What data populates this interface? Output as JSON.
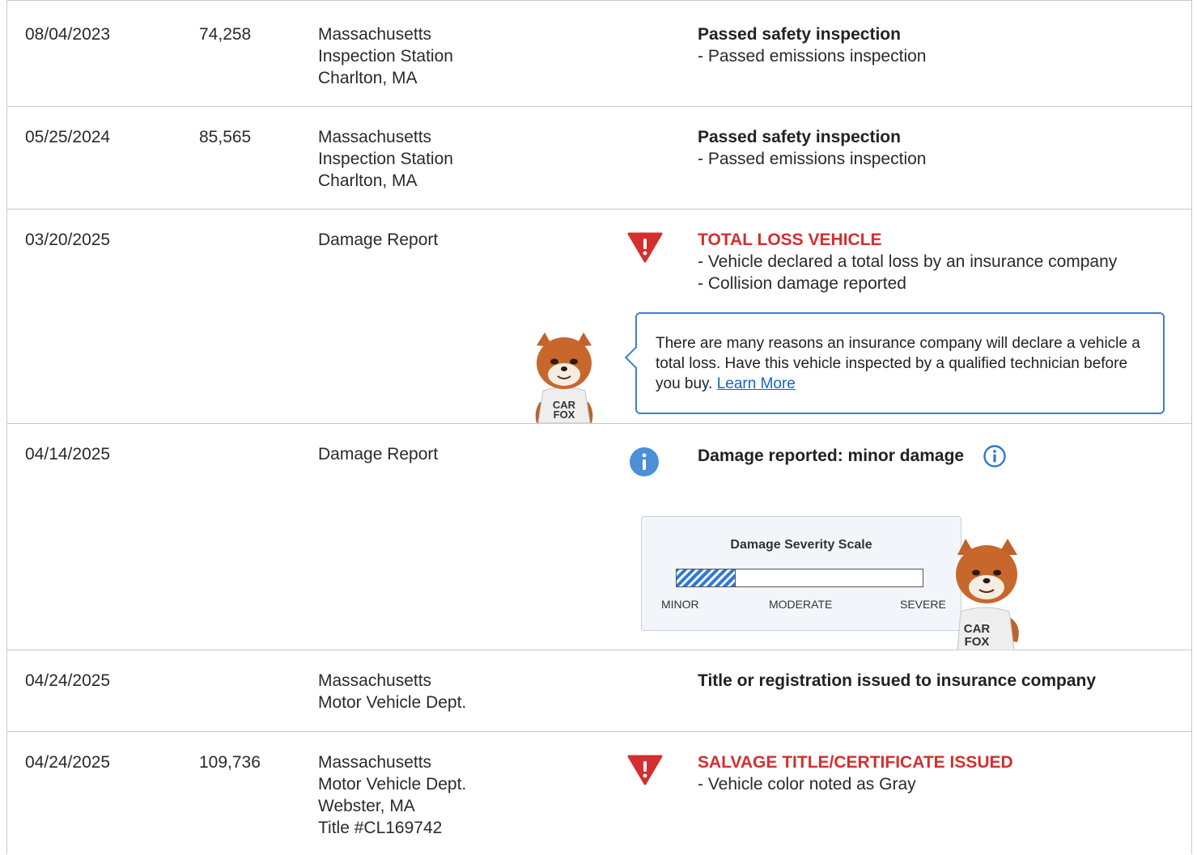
{
  "rows": [
    {
      "date": "08/04/2023",
      "odometer": "74,258",
      "source": [
        "Massachusetts",
        "Inspection Station",
        "Charlton, MA"
      ],
      "headline": "Passed safety inspection",
      "details": [
        "Passed emissions inspection"
      ]
    },
    {
      "date": "05/25/2024",
      "odometer": "85,565",
      "source": [
        "Massachusetts",
        "Inspection Station",
        "Charlton, MA"
      ],
      "headline": "Passed safety inspection",
      "details": [
        "Passed emissions inspection"
      ]
    },
    {
      "date": "03/20/2025",
      "odometer": "",
      "source": [
        "Damage Report"
      ],
      "headline": "TOTAL LOSS VEHICLE",
      "details": [
        "Vehicle declared a total loss by an insurance company",
        "Collision damage reported"
      ],
      "callout": {
        "text": "There are many reasons an insurance company will declare a vehicle a total loss. Have this vehicle inspected by a qualified technician before you buy.",
        "link": "Learn More"
      }
    },
    {
      "date": "04/14/2025",
      "odometer": "",
      "source": [
        "Damage Report"
      ],
      "headline": "Damage reported: minor damage",
      "details": [],
      "scale": {
        "title": "Damage Severity Scale",
        "labels": [
          "MINOR",
          "MODERATE",
          "SEVERE"
        ],
        "level_fraction": 0.24
      }
    },
    {
      "date": "04/24/2025",
      "odometer": "",
      "source": [
        "Massachusetts",
        "Motor Vehicle Dept."
      ],
      "headline": "Title or registration issued to insurance company",
      "details": []
    },
    {
      "date": "04/24/2025",
      "odometer": "109,736",
      "source": [
        "Massachusetts",
        "Motor Vehicle Dept.",
        "Webster, MA",
        "Title #CL169742"
      ],
      "headline": "SALVAGE TITLE/CERTIFICATE ISSUED",
      "details": [
        "Vehicle color noted as Gray"
      ]
    }
  ],
  "mascot": {
    "shirt_line1": "CAR",
    "shirt_line2": "FOX"
  },
  "colors": {
    "alert_red": "#d32f2f",
    "info_blue": "#3b7fd4",
    "link_blue": "#1565c0"
  },
  "icons": {
    "alert": "alert-triangle-icon",
    "info": "info-circle-icon"
  }
}
